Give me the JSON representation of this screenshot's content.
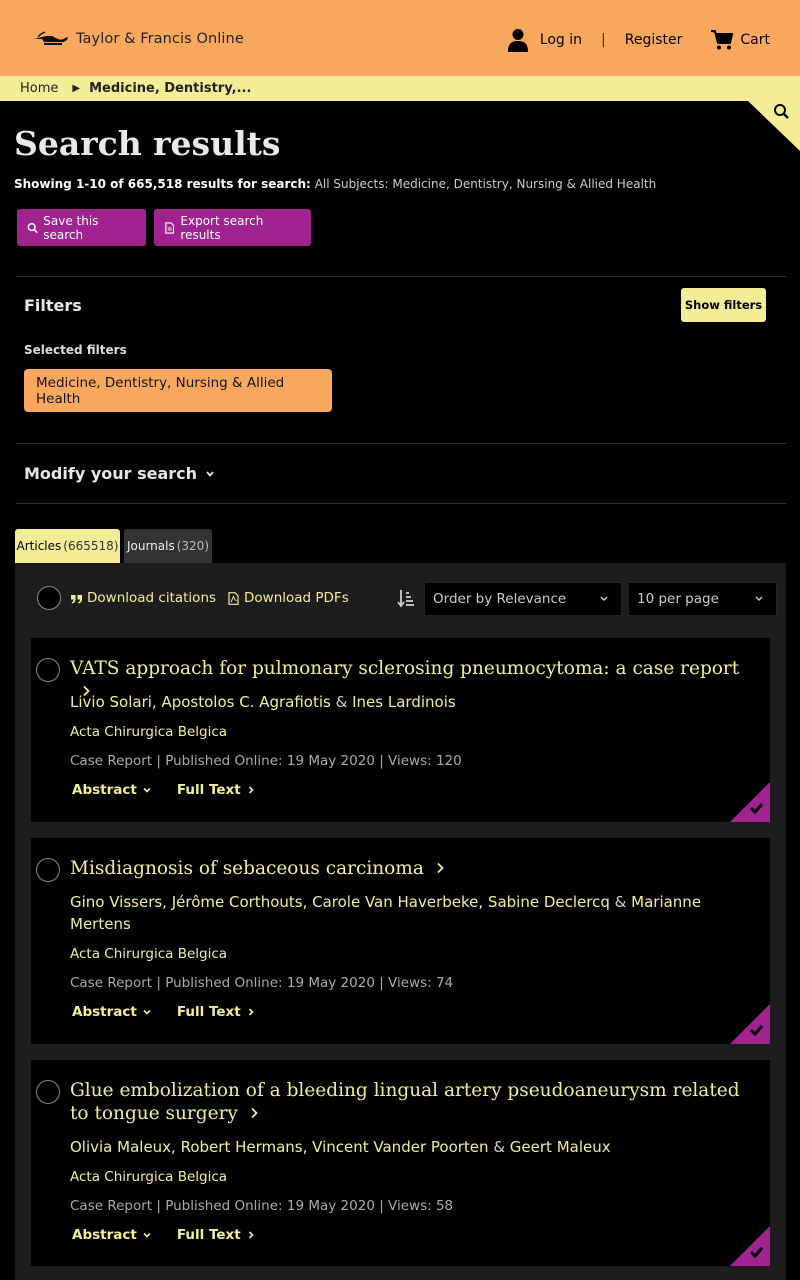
{
  "header": {
    "logo_text": "Taylor & Francis Online",
    "login": "Log in",
    "separator": "|",
    "register": "Register",
    "cart": "Cart",
    "brand_color": "#f9a85e"
  },
  "breadcrumb": {
    "home": "Home",
    "current": "Medicine, Dentistry,..."
  },
  "search": {
    "title": "Search results",
    "summary_bold": "Showing 1-10 of 665,518 results for search:",
    "summary_query": "All Subjects: Medicine, Dentistry, Nursing & Allied Health",
    "save_button": "Save this search",
    "export_button": "Export search results"
  },
  "filters": {
    "title": "Filters",
    "show_button": "Show filters",
    "selected_label": "Selected filters",
    "chip": "Medicine, Dentistry, Nursing & Allied Health",
    "modify": "Modify your search"
  },
  "tabs": [
    {
      "label": "Articles",
      "count": "(665518)"
    },
    {
      "label": "Journals",
      "count": "(320)"
    }
  ],
  "toolbar": {
    "download_citations": "Download citations",
    "download_pdfs": "Download PDFs",
    "order": "Order by Relevance",
    "per_page": "10 per page"
  },
  "results": [
    {
      "title": "VATS approach for pulmonary sclerosing pneumocytoma: a case report",
      "authors_a": "Livio Solari, Apostolos C. Agrafiotis",
      "amp": "&",
      "authors_b": "Ines Lardinois",
      "journal": "Acta Chirurgica Belgica",
      "meta": "Case Report | Published Online: 19 May 2020 | Views: 120",
      "abstract": "Abstract",
      "full_text": "Full Text"
    },
    {
      "title": "Misdiagnosis of sebaceous carcinoma",
      "authors_a": "Gino Vissers, Jérôme Corthouts, Carole Van Haverbeke, Sabine Declercq",
      "amp": "&",
      "authors_b": "Marianne Mertens",
      "journal": "Acta Chirurgica Belgica",
      "meta": "Case Report | Published Online: 19 May 2020 | Views: 74",
      "abstract": "Abstract",
      "full_text": "Full Text"
    },
    {
      "title": "Glue embolization of a bleeding lingual artery pseudoaneurysm related to tongue surgery",
      "authors_a": "Olivia Maleux, Robert Hermans, Vincent Vander Poorten",
      "amp": "&",
      "authors_b": "Geert Maleux",
      "journal": "Acta Chirurgica Belgica",
      "meta": "Case Report | Published Online: 19 May 2020 | Views: 58",
      "abstract": "Abstract",
      "full_text": "Full Text"
    }
  ]
}
